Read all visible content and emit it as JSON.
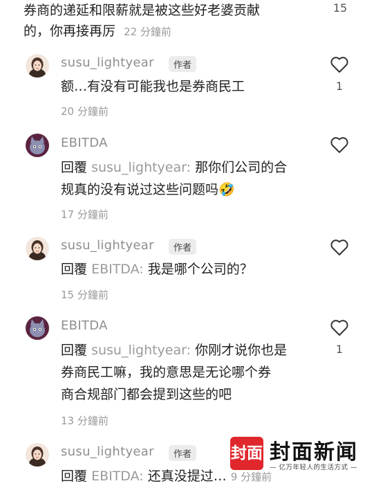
{
  "top_comment": {
    "line1": "券商的递延和限薪就是被这些好老婆贡献",
    "line2": "的，你再接再厉",
    "time": "22 分鐘前",
    "likes": "15"
  },
  "replies": [
    {
      "user": "susu_lightyear",
      "badge": "作者",
      "lines": [
        "额…有没有可能我也是券商民工"
      ],
      "time": "20 分鐘前",
      "likes": "1"
    },
    {
      "user": "EBITDA",
      "reply_prefix": "回覆",
      "reply_to": "susu_lightyear:",
      "first_line_rest": "那你们公司的合",
      "lines": [
        "规真的没有说过这些问题吗🤣"
      ],
      "time": "17 分鐘前",
      "likes": ""
    },
    {
      "user": "susu_lightyear",
      "badge": "作者",
      "reply_prefix": "回覆",
      "reply_to": "EBITDA:",
      "first_line_rest": "我是哪个公司的？",
      "time": "15 分鐘前",
      "likes": ""
    },
    {
      "user": "EBITDA",
      "reply_prefix": "回覆",
      "reply_to": "susu_lightyear:",
      "first_line_rest": "你刚才说你也是",
      "lines": [
        "券商民工嘛，我的意思是无论哪个券",
        "商合规部门都会提到这些的吧"
      ],
      "time": "13 分鐘前",
      "likes": "1"
    },
    {
      "user": "susu_lightyear",
      "badge": "作者",
      "reply_prefix": "回覆",
      "reply_to": "EBITDA:",
      "first_line_rest": "还真没提过…",
      "time": "9 分鐘前"
    }
  ],
  "watermark": {
    "logo": "封面",
    "title": "封面新闻",
    "subtitle": "— 亿万年轻人的生活方式 —"
  },
  "colors": {
    "text": "#222222",
    "muted": "#9a9a9a",
    "brand_red": "#e0272c"
  }
}
